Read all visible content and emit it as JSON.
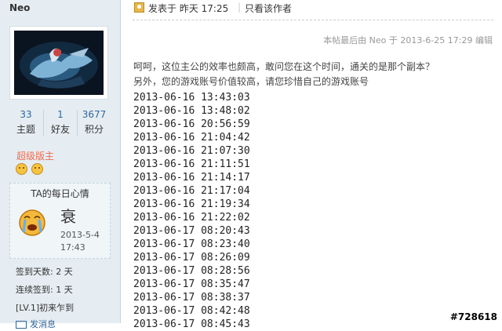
{
  "sidebar": {
    "username": "Neo",
    "stats": [
      {
        "value": "33",
        "label": "主题"
      },
      {
        "value": "1",
        "label": "好友"
      },
      {
        "value": "3677",
        "label": "积分"
      }
    ],
    "usergroup": "超级版主",
    "mood": {
      "title": "TA的每日心情",
      "word": "衰",
      "date": "2013-5-4",
      "time": "17:43"
    },
    "checkin_days": "签到天数: 2 天",
    "consecutive_checkin": "连续签到: 1 天",
    "level": "[LV.1]初来乍到",
    "send_message": "发消息"
  },
  "post": {
    "time": "发表于 昨天 17:25",
    "only_author": "只看该作者",
    "edit_note": "本帖最后由 Neo 于 2013-6-25 17:29 编辑",
    "paragraphs": [
      "呵呵，这位主公的效率也颇高，敢问您在这个时间，通关的是那个副本？",
      "另外，您的游戏账号价值较高，请您珍惜自己的游戏账号"
    ],
    "timestamps": [
      "2013-06-16 13:43:03",
      "2013-06-16 13:48:02",
      "2013-06-16 20:56:59",
      "2013-06-16 21:04:42",
      "2013-06-16 21:07:30",
      "2013-06-16 21:11:51",
      "2013-06-16 21:14:17",
      "2013-06-16 21:17:04",
      "2013-06-16 21:19:34",
      "2013-06-16 21:22:02",
      "2013-06-17 08:20:43",
      "2013-06-17 08:23:40",
      "2013-06-17 08:26:09",
      "2013-06-17 08:28:56",
      "2013-06-17 08:35:47",
      "2013-06-17 08:38:37",
      "2013-06-17 08:42:48",
      "2013-06-17 08:45:43"
    ]
  },
  "watermark": "#728618",
  "colors": {
    "sidebar_bg": "#e5edf2",
    "usergroup": "#f26c4f",
    "stat_number": "#336699"
  }
}
